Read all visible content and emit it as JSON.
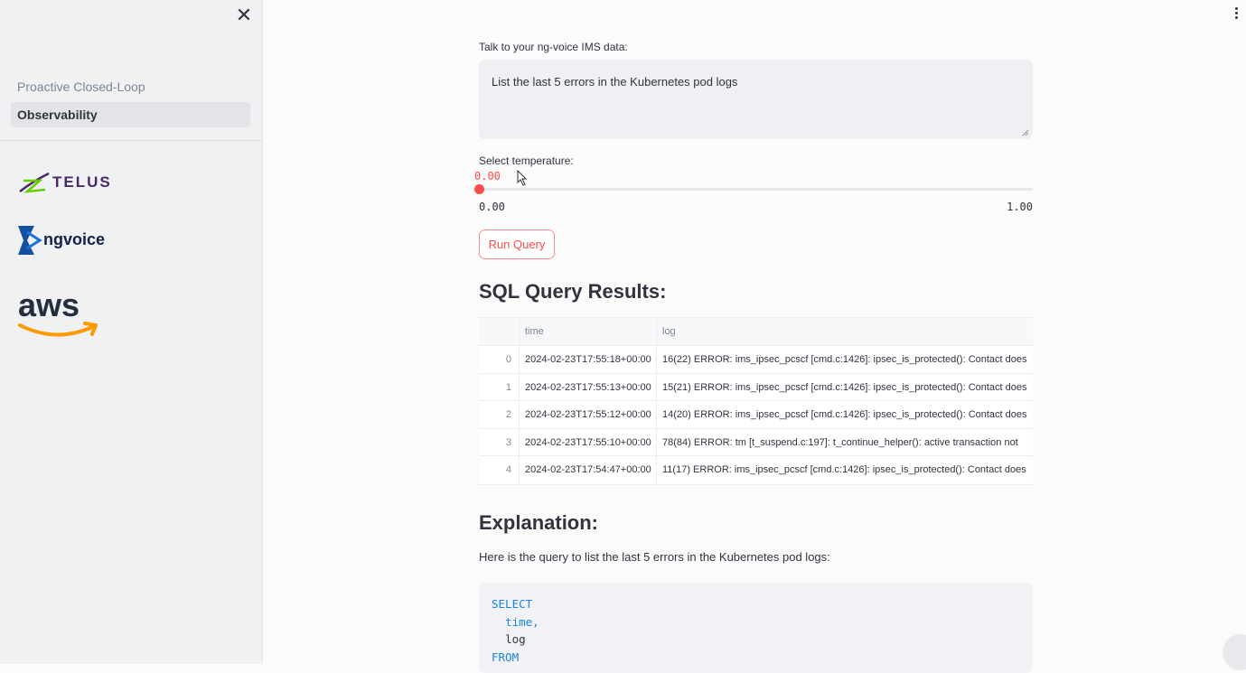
{
  "sidebar": {
    "close_label": "✕",
    "nav": [
      {
        "label": "Proactive Closed-Loop",
        "active": false
      },
      {
        "label": "Observability",
        "active": true
      }
    ],
    "logos": {
      "telus": "TELUS",
      "ngvoice": "ngvoice",
      "aws": "aws"
    }
  },
  "main": {
    "query_label": "Talk to your ng-voice IMS data:",
    "query_value": "List the last 5 errors in the Kubernetes pod logs",
    "temperature": {
      "label": "Select temperature:",
      "value": "0.00",
      "min": "0.00",
      "max": "1.00",
      "level": 0
    },
    "run_button": "Run Query",
    "results_title": "SQL Query Results:",
    "table": {
      "columns": [
        "",
        "time",
        "log"
      ],
      "rows": [
        {
          "idx": "0",
          "time": "2024-02-23T17:55:18+00:00",
          "log": "16(22) ERROR: ims_ipsec_pcscf [cmd.c:1426]: ipsec_is_protected(): Contact does"
        },
        {
          "idx": "1",
          "time": "2024-02-23T17:55:13+00:00",
          "log": "15(21) ERROR: ims_ipsec_pcscf [cmd.c:1426]: ipsec_is_protected(): Contact does"
        },
        {
          "idx": "2",
          "time": "2024-02-23T17:55:12+00:00",
          "log": "14(20) ERROR: ims_ipsec_pcscf [cmd.c:1426]: ipsec_is_protected(): Contact does"
        },
        {
          "idx": "3",
          "time": "2024-02-23T17:55:10+00:00",
          "log": "78(84) ERROR: tm [t_suspend.c:197]: t_continue_helper(): active transaction not"
        },
        {
          "idx": "4",
          "time": "2024-02-23T17:54:47+00:00",
          "log": "11(17) ERROR: ims_ipsec_pcscf [cmd.c:1426]: ipsec_is_protected(): Contact does"
        }
      ]
    },
    "explanation_title": "Explanation:",
    "explanation_text": "Here is the query to list the last 5 errors in the Kubernetes pod logs:",
    "code": {
      "line1": "SELECT",
      "line2": "time,",
      "line3": "log",
      "line4": "FROM"
    }
  },
  "colors": {
    "accent": "#ff4b4b",
    "sidebar_bg": "#eff1f3",
    "code_keyword": "#1c83e1"
  },
  "icons": {
    "close": "close-icon",
    "menu": "kebab-menu-icon",
    "cursor": "mouse-pointer-icon"
  }
}
